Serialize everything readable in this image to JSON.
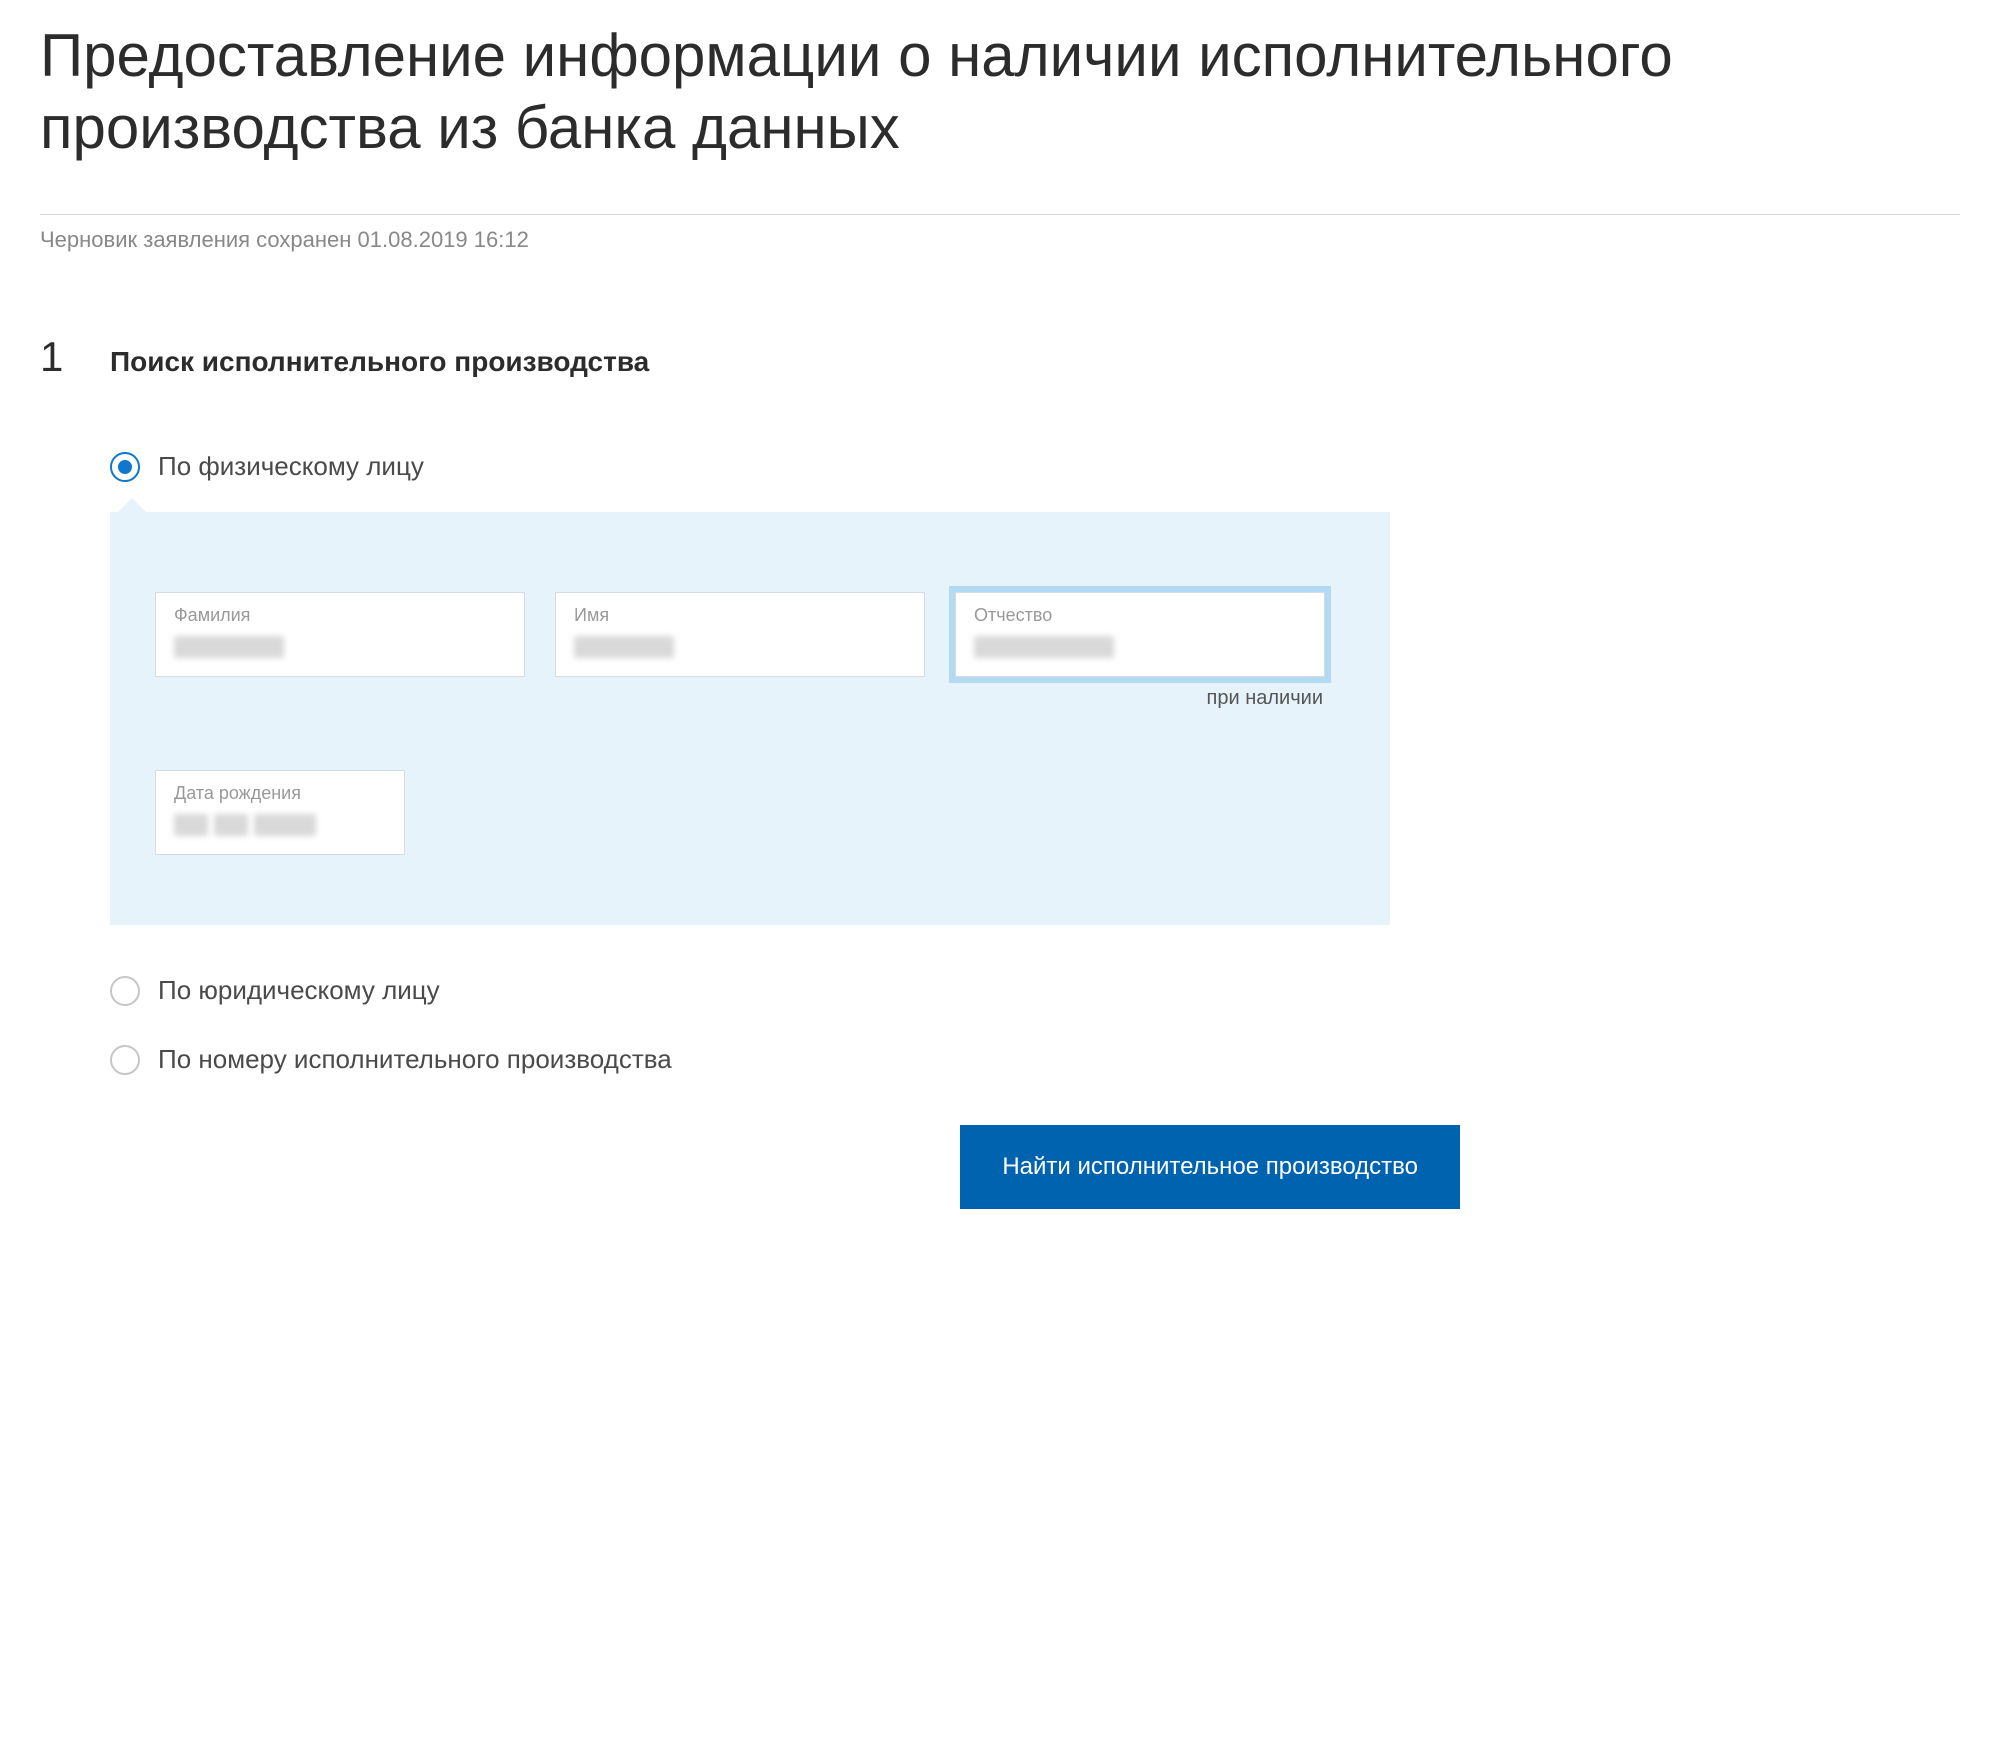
{
  "header": {
    "title": "Предоставление информации о наличии исполнительного производства из банка данных"
  },
  "draft_status": "Черновик заявления сохранен 01.08.2019 16:12",
  "step": {
    "number": "1",
    "title": "Поиск исполнительного производства"
  },
  "radios": {
    "individual": "По физическому лицу",
    "legal": "По юридическому лицу",
    "by_number": "По номеру исполнительного производства"
  },
  "fields": {
    "surname_label": "Фамилия",
    "name_label": "Имя",
    "patronymic_label": "Отчество",
    "patronymic_hint": "при наличии",
    "dob_label": "Дата рождения"
  },
  "submit_label": "Найти исполнительное производство"
}
